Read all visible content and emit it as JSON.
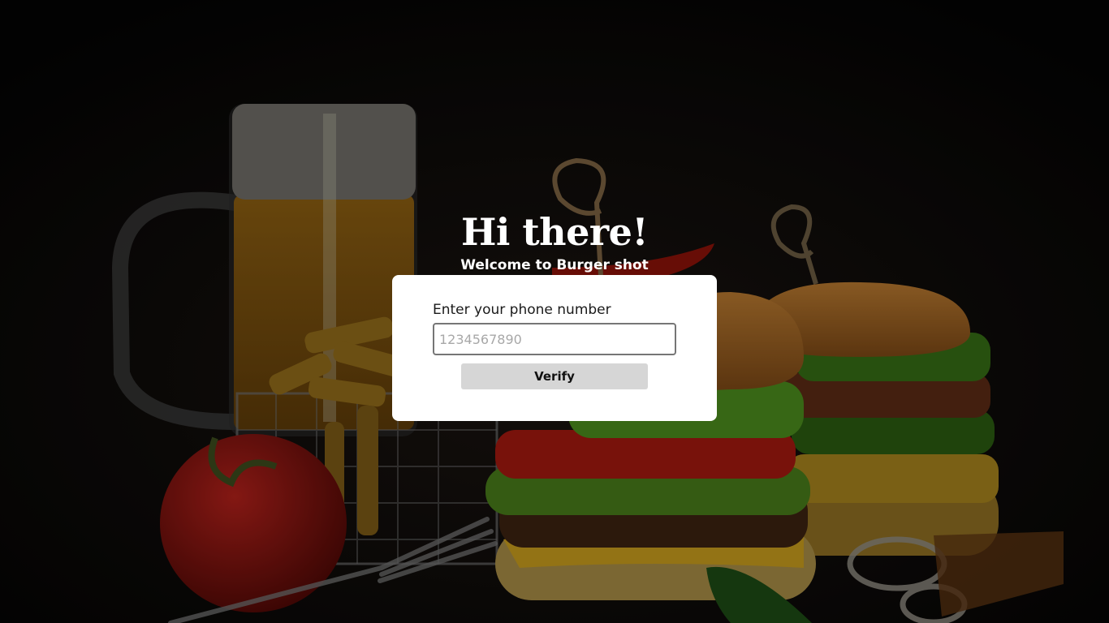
{
  "hero": {
    "title": "Hi there!",
    "subtitle": "Welcome to Burger shot"
  },
  "form": {
    "phone_label": "Enter your phone number",
    "phone_placeholder": "1234567890",
    "phone_value": "",
    "verify_label": "Verify"
  },
  "colors": {
    "page_background": "#050505",
    "card_background": "#ffffff",
    "button_background": "#d6d6d6",
    "input_border": "#767676"
  }
}
